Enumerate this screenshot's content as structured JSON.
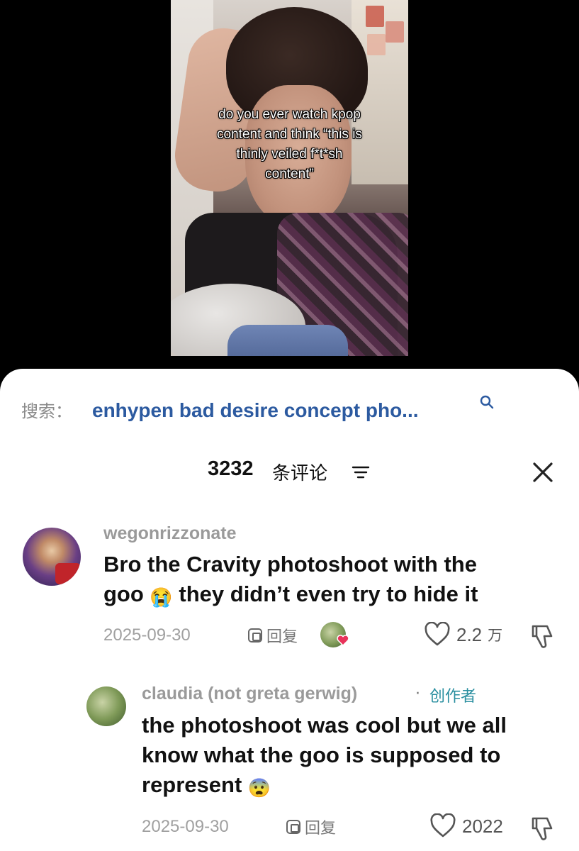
{
  "video": {
    "caption_lines": [
      "do you ever watch kpop",
      "content and think “this is",
      "thinly veiled f*t*sh",
      "content”"
    ]
  },
  "search": {
    "prefix": "搜索：",
    "query": "enhypen bad desire concept pho...",
    "icon": "search-icon"
  },
  "comments_header": {
    "count": "3232",
    "label": "条评论",
    "sort_icon": "sort-icon",
    "close_icon": "close-icon"
  },
  "comments": [
    {
      "username": "wegonrizzonate",
      "text_line1": "Bro the Cravity photoshoot with the",
      "text_line2_pre": "goo ",
      "emoji": "😭",
      "text_line2_post": " they didn’t even try to hide it",
      "date": "2025-09-30",
      "reply_label": "回复",
      "likes": "2.2",
      "likes_unit": "万",
      "liked_by_creator": true
    },
    {
      "username": "claudia (not greta gerwig)",
      "creator_separator": "·",
      "creator_tag": "创作者",
      "text_line1": "the photoshoot was cool but we all",
      "text_line2": "know what the goo is supposed to",
      "text_line3_pre": "represent ",
      "emoji": "😨",
      "date": "2025-09-30",
      "reply_label": "回复",
      "likes": "2022"
    }
  ],
  "colors": {
    "accent_blue": "#2c5aa0",
    "creator_teal": "#2a8fa0",
    "like_heart": "#e8335a"
  }
}
